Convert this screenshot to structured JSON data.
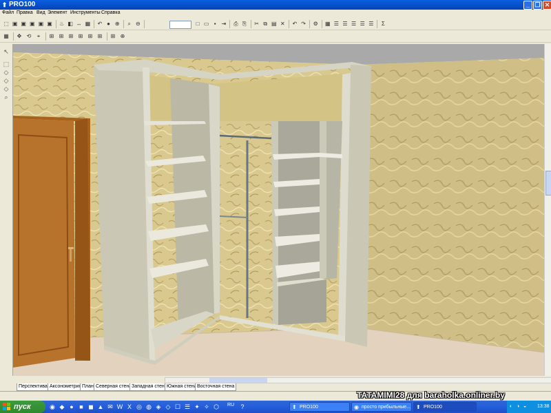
{
  "window": {
    "title": "PRO100"
  },
  "menu": [
    "Файл",
    "Правка",
    "Вид",
    "Элемент",
    "Инструменты",
    "Справка"
  ],
  "tabs": [
    "Перспектива",
    "Аксонометрия",
    "План",
    "Северная стена",
    "Западная стена",
    "Южная стена",
    "Восточная стена"
  ],
  "taskbar": {
    "start_label": "пуск",
    "language": "RU",
    "buttons": [
      "PRO100",
      "просто прибыльные...",
      "PRO100"
    ],
    "clock": "13:38"
  },
  "watermark": "TATAMIMI28 для baraholka.onliner.by",
  "icons": {
    "toolbar1": [
      "open-box-icon",
      "box-icon",
      "box-icon",
      "box-icon",
      "box-icon",
      "box-icon",
      "light-bulb-icon",
      "material-icon",
      "dimension-icon",
      "texture-icon",
      "undo-icon",
      "sphere-icon",
      "target-icon",
      "zoom-icon",
      "zoom-out-icon",
      "new-icon",
      "open-icon",
      "save-icon",
      "export-icon",
      "print-icon",
      "print-preview-icon",
      "cut-icon",
      "copy-icon",
      "paste-icon",
      "delete-icon",
      "undo-icon",
      "redo-icon",
      "properties-icon",
      "grid-icon",
      "list-icon",
      "list-icon",
      "list-icon",
      "list-icon",
      "list-icon",
      "sum-icon"
    ],
    "toolbar2": [
      "grid-icon",
      "move-icon",
      "rotate-icon",
      "pin-icon",
      "align-icon",
      "align-icon",
      "align-icon",
      "align-icon",
      "align-icon",
      "align-icon",
      "align-icon",
      "target-icon"
    ],
    "lefttools": [
      "cursor-icon",
      "select-icon",
      "shape-icon",
      "shape-icon",
      "shape-icon",
      "zoom-icon"
    ]
  },
  "colors": {
    "titlebar": "#0a5fe0",
    "taskbar": "#245edb",
    "start": "#3c9b3c",
    "wall": "#d9c98e",
    "floor": "#e3d2bd",
    "cabinet": "#c9c6b2"
  }
}
